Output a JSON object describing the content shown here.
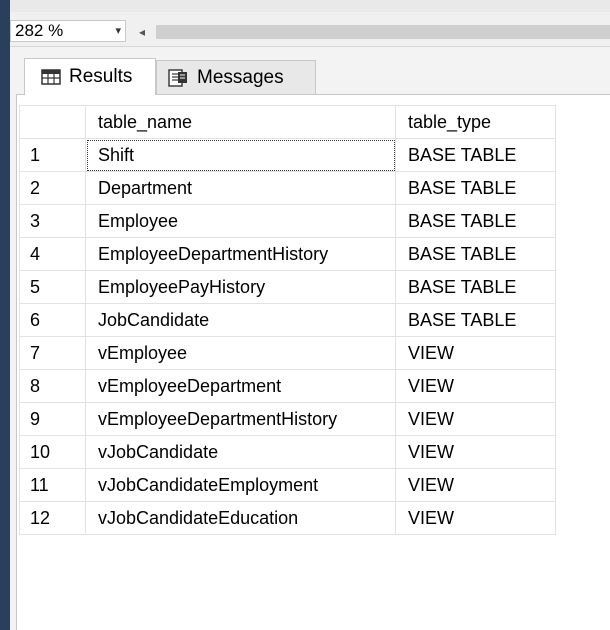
{
  "toolbar": {
    "zoom_level": "282 %",
    "zoom_arrow_glyph": "▾",
    "scroll_left_glyph": "◂"
  },
  "tabs": [
    {
      "label": "Results",
      "icon": "grid-icon",
      "active": true
    },
    {
      "label": "Messages",
      "icon": "messages-icon",
      "active": false
    }
  ],
  "grid": {
    "columns": [
      "table_name",
      "table_type"
    ],
    "rows": [
      {
        "num": "1",
        "table_name": "Shift",
        "table_type": "BASE TABLE"
      },
      {
        "num": "2",
        "table_name": "Department",
        "table_type": "BASE TABLE"
      },
      {
        "num": "3",
        "table_name": "Employee",
        "table_type": "BASE TABLE"
      },
      {
        "num": "4",
        "table_name": "EmployeeDepartmentHistory",
        "table_type": "BASE TABLE"
      },
      {
        "num": "5",
        "table_name": "EmployeePayHistory",
        "table_type": "BASE TABLE"
      },
      {
        "num": "6",
        "table_name": "JobCandidate",
        "table_type": "BASE TABLE"
      },
      {
        "num": "7",
        "table_name": "vEmployee",
        "table_type": "VIEW"
      },
      {
        "num": "8",
        "table_name": "vEmployeeDepartment",
        "table_type": "VIEW"
      },
      {
        "num": "9",
        "table_name": "vEmployeeDepartmentHistory",
        "table_type": "VIEW"
      },
      {
        "num": "10",
        "table_name": "vJobCandidate",
        "table_type": "VIEW"
      },
      {
        "num": "11",
        "table_name": "vJobCandidateEmployment",
        "table_type": "VIEW"
      },
      {
        "num": "12",
        "table_name": "vJobCandidateEducation",
        "table_type": "VIEW"
      }
    ]
  }
}
